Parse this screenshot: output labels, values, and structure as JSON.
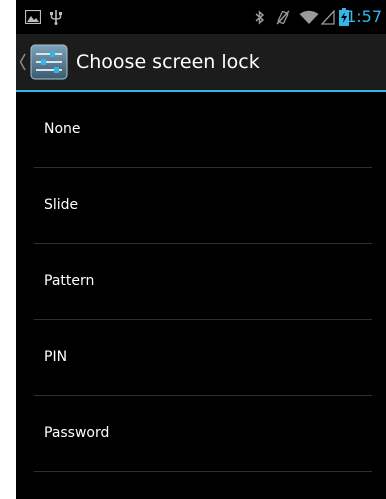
{
  "status_bar": {
    "time": "1:57",
    "left_icons": [
      "image-notification-icon",
      "usb-icon"
    ],
    "right_icons": [
      "bluetooth-icon",
      "vibrate-mute-icon",
      "wifi-icon",
      "signal-icon",
      "battery-charging-icon"
    ]
  },
  "action_bar": {
    "title": "Choose screen lock",
    "icon": "settings-app-icon"
  },
  "list": {
    "items": [
      {
        "label": "None"
      },
      {
        "label": "Slide"
      },
      {
        "label": "Pattern"
      },
      {
        "label": "PIN"
      },
      {
        "label": "Password"
      }
    ]
  },
  "colors": {
    "accent": "#33b5e5",
    "background": "#000000",
    "action_bar": "#1c1c1c",
    "text": "#ffffff",
    "divider": "#2e2e2e"
  }
}
